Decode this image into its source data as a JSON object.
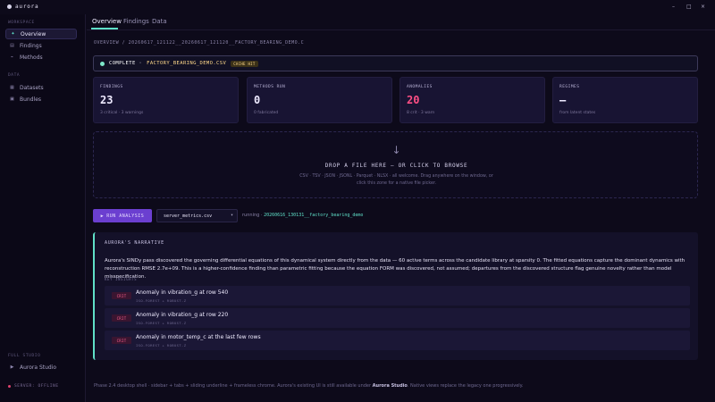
{
  "app": {
    "name": "aurora"
  },
  "window_controls": [
    "–",
    "□",
    "×"
  ],
  "sidebar": {
    "workspace_heading": "WORKSPACE",
    "workspace_items": [
      {
        "label": "Overview",
        "icon": "sparkle-icon",
        "glyph": "✦",
        "active": true
      },
      {
        "label": "Findings",
        "icon": "list-icon",
        "glyph": "▤",
        "active": false
      },
      {
        "label": "Methods",
        "icon": "function-icon",
        "glyph": "⌁",
        "active": false
      }
    ],
    "data_heading": "DATA",
    "data_items": [
      {
        "label": "Datasets",
        "icon": "grid-icon",
        "glyph": "▦"
      },
      {
        "label": "Bundles",
        "icon": "package-icon",
        "glyph": "▣"
      }
    ],
    "full_studio_heading": "FULL STUDIO",
    "studio_item": {
      "label": "Aurora Studio",
      "icon": "play-icon",
      "glyph": "▶"
    },
    "status": "SERVER: OFFLINE",
    "status_color": "#e0436e"
  },
  "tabs": [
    {
      "label": "Overview",
      "active": true
    },
    {
      "label": "Findings",
      "active": false
    },
    {
      "label": "Data",
      "active": false
    }
  ],
  "breadcrumb": "OVERVIEW / 20260617_121122__20260617_121120__FACTORY_BEARING_DEMO.C",
  "banner": {
    "status": "COMPLETE ·",
    "file": "FACTORY_BEARING_DEMO.CSV",
    "badge": "CACHE HIT"
  },
  "cards": [
    {
      "label": "FINDINGS",
      "value": "23",
      "sub": "3 critical · 3 warnings",
      "accent": false
    },
    {
      "label": "METHODS RUN",
      "value": "0",
      "sub": "0 fabricated",
      "accent": false
    },
    {
      "label": "ANOMALIES",
      "value": "20",
      "sub": "8 crit · 3 warn",
      "accent": true
    },
    {
      "label": "REGIMES",
      "value": "–",
      "sub": "from latent states",
      "accent": false
    }
  ],
  "dropzone": {
    "arrow": "↓",
    "title": "DROP A FILE HERE — OR CLICK TO BROWSE",
    "subtitle_line1": "CSV · TSV · JSON · JSONL · Parquet · NLSX · all welcome. Drag anywhere on the window, or",
    "subtitle_line2": "click this zone for a native file picker."
  },
  "run": {
    "button_icon": "▶",
    "button_label": "RUN ANALYSIS",
    "selected_file": "server_metrics.csv",
    "caret": "▾",
    "running_prefix": "running · ",
    "running_id": "20260616_130131__factory_bearing_demo"
  },
  "narrative": {
    "heading": "AURORA'S NARRATIVE",
    "body": "Aurora's SINDy pass discovered the governing differential equations of this dynamical system directly from the data — 60 active terms across the candidate library at sparsity 0. The fitted equations capture the dominant dynamics with reconstruction RMSE 2.7e+09. This is a higher-confidence finding than parametric fitting because the equation FORM was discovered, not assumed; departures from the discovered structure flag genuine novelty rather than model misspecification.",
    "key_heading": "KEY INSIGHTS",
    "insights": [
      {
        "severity": "CRIT",
        "title": "Anomaly in vibration_g at row 540",
        "meta": "ISO-FOREST + ROBUST-Z"
      },
      {
        "severity": "CRIT",
        "title": "Anomaly in vibration_g at row 220",
        "meta": "ISO-FOREST + ROBUST-Z"
      },
      {
        "severity": "CRIT",
        "title": "Anomaly in motor_temp_c at the last few rows",
        "meta": "ISO-FOREST + ROBUST-Z"
      }
    ]
  },
  "footer": {
    "prefix": "Phase 2.4 desktop shell · sidebar + tabs + sliding underline + frameless chrome. Aurora's existing UI is still available under",
    "link": "Aurora Studio",
    "suffix": ". Native views replace the legacy one progressively."
  },
  "colors": {
    "accent": "#5fe0c8",
    "crit": "#ff4f85",
    "button": "#6b3fd0",
    "background": "#0d0a1a"
  }
}
